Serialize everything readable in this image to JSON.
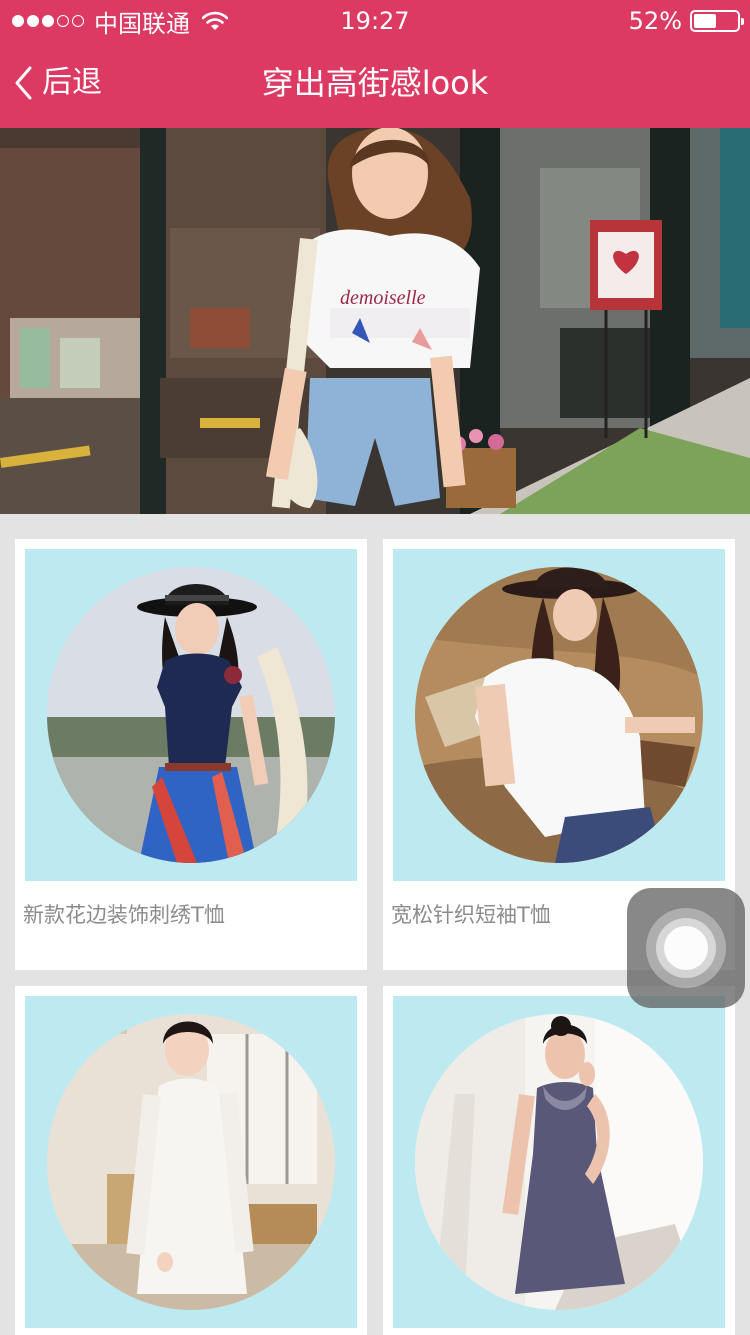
{
  "status_bar": {
    "signal_dots_filled": 3,
    "signal_dots_total": 5,
    "carrier": "中国联通",
    "time": "19:27",
    "battery_percent_text": "52%",
    "battery_level": 0.52
  },
  "nav": {
    "back_label": "后退",
    "title": "穿出高街感look"
  },
  "colors": {
    "brand": "#dc3a63",
    "card_photo_bg": "#bde9f1",
    "page_bg": "#e3e3e3",
    "product_title": "#8c8c8c"
  },
  "products": [
    {
      "title": "新款花边装饰刺绣T恤"
    },
    {
      "title": "宽松针织短袖T恤"
    },
    {
      "title": ""
    },
    {
      "title": ""
    }
  ],
  "icons": {
    "back": "chevron-left-icon",
    "wifi": "wifi-icon",
    "battery": "battery-icon",
    "assistive_touch": "assistive-touch-icon"
  }
}
